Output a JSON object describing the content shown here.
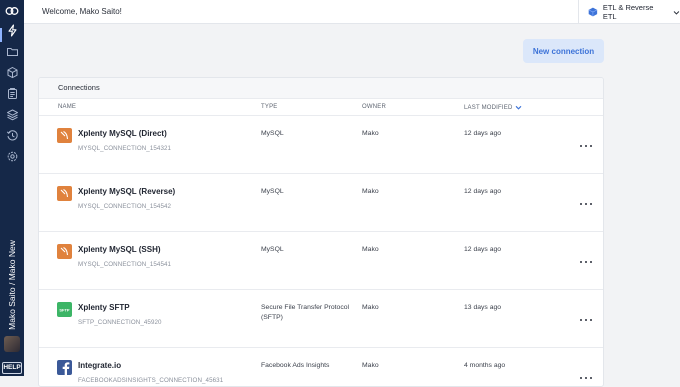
{
  "topbar": {
    "welcome": "Welcome, Mako Saito!",
    "environment": "ETL & Reverse ETL",
    "environment_icon": "cube-icon",
    "environment_icon_color": "#3d73d8"
  },
  "sidebar": {
    "user_label": "Mako Saito / Mako New",
    "help_label": "HELP",
    "icons": [
      "logo-icon",
      "lightning-icon",
      "folder-icon",
      "package-icon",
      "clipboard-icon",
      "layers-icon",
      "history-icon",
      "settings-icon"
    ],
    "background": "#152848"
  },
  "actions": {
    "new_connection": "New connection"
  },
  "connections": {
    "title": "Connections",
    "columns": {
      "name": "NAME",
      "type": "TYPE",
      "owner": "OWNER",
      "last_modified": "LAST MODIFIED"
    },
    "rows": [
      {
        "name": "Xplenty MySQL (Direct)",
        "id": "MYSQL_CONNECTION_154321",
        "type": "MySQL",
        "owner": "Mako",
        "modified": "12 days ago",
        "icon": "mysql-icon"
      },
      {
        "name": "Xplenty MySQL (Reverse)",
        "id": "MYSQL_CONNECTION_154542",
        "type": "MySQL",
        "owner": "Mako",
        "modified": "12 days ago",
        "icon": "mysql-icon"
      },
      {
        "name": "Xplenty MySQL (SSH)",
        "id": "MYSQL_CONNECTION_154541",
        "type": "MySQL",
        "owner": "Mako",
        "modified": "12 days ago",
        "icon": "mysql-icon"
      },
      {
        "name": "Xplenty SFTP",
        "id": "SFTP_CONNECTION_45920",
        "type": "Secure File Transfer Protocol (SFTP)",
        "owner": "Mako",
        "modified": "13 days ago",
        "icon": "sftp-icon",
        "icon_text": "SFTP"
      },
      {
        "name": "Integrate.io",
        "id": "FACEBOOKADSINSIGHTS_CONNECTION_45631",
        "type": "Facebook Ads Insights",
        "owner": "Mako",
        "modified": "4 months ago",
        "icon": "facebook-icon"
      }
    ]
  },
  "colors": {
    "mysql": "#e0823d",
    "sftp": "#3cb566",
    "facebook": "#3b5998",
    "accent": "#3d73d8"
  }
}
